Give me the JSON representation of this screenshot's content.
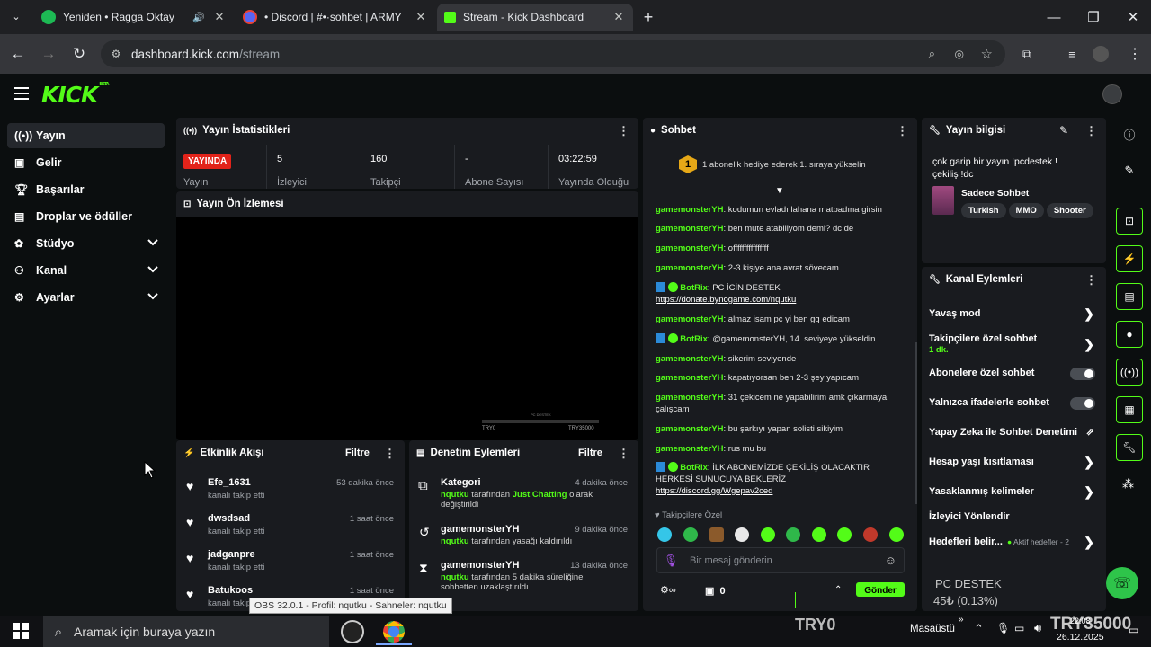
{
  "browser": {
    "tabs": [
      {
        "title": "Yeniden • Ragga Oktay",
        "icon": "spotify-icon",
        "color": "#1db954"
      },
      {
        "title": "• Discord | #•·sohbet | ARMY",
        "icon": "discord-icon",
        "color": "#5865f2"
      },
      {
        "title": "Stream - Kick Dashboard",
        "icon": "kick-icon",
        "color": "#53fc18"
      }
    ],
    "url_host": "dashboard.kick.com",
    "url_path": "/stream"
  },
  "brand": {
    "logo": "KICK",
    "beta": "BETA",
    "accent": "#53fc18"
  },
  "sidebar": {
    "items": [
      {
        "label": "Yayın",
        "icon": "broadcast-icon"
      },
      {
        "label": "Gelir",
        "icon": "revenue-icon"
      },
      {
        "label": "Başarılar",
        "icon": "trophy-icon"
      },
      {
        "label": "Droplar ve ödüller",
        "icon": "gift-icon"
      },
      {
        "label": "Stüdyo",
        "icon": "studio-icon"
      },
      {
        "label": "Kanal",
        "icon": "channel-icon"
      },
      {
        "label": "Ayarlar",
        "icon": "settings-icon"
      }
    ]
  },
  "stats": {
    "title": "Yayın İstatistikleri",
    "live_badge": "YAYINDA",
    "live_label": "Yayın",
    "viewers": "5",
    "viewers_label": "İzleyici",
    "followers": "160",
    "followers_label": "Takipçi",
    "subs": "-",
    "subs_label": "Abone Sayısı",
    "duration": "03:22:59",
    "duration_label": "Yayında Olduğu"
  },
  "preview": {
    "title": "Yayın Ön İzlemesi",
    "left_label": "TRY0",
    "right_label": "TRY35000",
    "top_label": "PC DESTEK"
  },
  "activity": {
    "title": "Etkinlik Akışı",
    "filter": "Filtre",
    "items": [
      {
        "name": "Efe_1631",
        "action": "kanalı takip etti",
        "time": "53 dakika önce"
      },
      {
        "name": "dwsdsad",
        "action": "kanalı takip etti",
        "time": "1 saat önce"
      },
      {
        "name": "jadganpre",
        "action": "kanalı takip etti",
        "time": "1 saat önce"
      },
      {
        "name": "Batukoos",
        "action": "kanalı takip etti",
        "time": "1 saat önce"
      }
    ]
  },
  "moderation": {
    "title": "Denetim Eylemleri",
    "filter": "Filtre",
    "items": [
      {
        "title": "Kategori",
        "actor": "nqutku",
        "text": " tarafından ",
        "highlight": "Just Chatting",
        "text2": " olarak değiştirildi",
        "time": "4 dakika önce"
      },
      {
        "title": "gamemonsterYH",
        "actor": "nqutku",
        "text": " tarafından yasağı kaldırıldı",
        "highlight": "",
        "text2": "",
        "time": "9 dakika önce"
      },
      {
        "title": "gamemonsterYH",
        "actor": "nqutku",
        "text": " tarafından 5 dakika süreliğine sohbetten uzaklaştırıldı",
        "highlight": "",
        "text2": "",
        "time": "13 dakika önce"
      }
    ]
  },
  "chat": {
    "title": "Sohbet",
    "gift_text": "1 abonelik hediye ederek 1. sıraya yükselin",
    "gift_badge": "1",
    "messages": [
      {
        "user": "gamemonsterYH",
        "text": "kodumun evladı lahana matbadına girsin",
        "link": ""
      },
      {
        "user": "gamemonsterYH",
        "text": "ben mute atabiliyom demi? dc de",
        "link": ""
      },
      {
        "user": "gamemonsterYH",
        "text": "offffffffffffffff",
        "link": ""
      },
      {
        "user": "gamemonsterYH",
        "text": "2-3 kişiye ana avrat sövecam",
        "link": ""
      },
      {
        "user": "BotRix",
        "text": "PC İCİN DESTEK",
        "link": "https://donate.bynogame.com/nqutku"
      },
      {
        "user": "gamemonsterYH",
        "text": "almaz isam pc yi ben gg edicam",
        "link": ""
      },
      {
        "user": "BotRix",
        "text": "@gamemonsterYH, 14. seviyeye yükseldin",
        "link": ""
      },
      {
        "user": "gamemonsterYH",
        "text": "sikerim seviyende",
        "link": ""
      },
      {
        "user": "gamemonsterYH",
        "text": "kapatıyorsan ben 2-3 şey yapıcam",
        "link": ""
      },
      {
        "user": "gamemonsterYH",
        "text": "31 çekicem ne yapabilirim amk çıkarmaya çalışcam",
        "link": ""
      },
      {
        "user": "gamemonsterYH",
        "text": "bu şarkıyı yapan solisti sikiyim",
        "link": ""
      },
      {
        "user": "gamemonsterYH",
        "text": "rus mu bu",
        "link": ""
      },
      {
        "user": "BotRix",
        "text": "İLK ABONEMİZDE ÇEKİLİŞ OLACAKTIR HERKESİ SUNUCUYA BEKLERİZ",
        "link": "https://discord.gg/Wgepav2ced"
      }
    ],
    "emote_label": "Takipçilere Özel",
    "input_placeholder": "Bir mesaj gönderin",
    "count": "0",
    "send_label": "Gönder"
  },
  "stream_info": {
    "title": "Yayın bilgisi",
    "stream_title": "çok garip bir yayın !pcdestek ! çekiliş !dc",
    "category": "Sadece Sohbet",
    "tags": [
      "Turkish",
      "MMO",
      "Shooter"
    ]
  },
  "channel_actions": {
    "title": "Kanal Eylemleri",
    "rows": [
      {
        "label": "Yavaş mod",
        "sub": "",
        "control": "chevron"
      },
      {
        "label": "Takipçilere özel sohbet",
        "sub": "1 dk.",
        "control": "chevron"
      },
      {
        "label": "Abonelere özel sohbet",
        "sub": "",
        "control": "toggle"
      },
      {
        "label": "Yalnızca ifadelerle sohbet",
        "sub": "",
        "control": "toggle"
      },
      {
        "label": "Yapay Zeka ile Sohbet Denetimi",
        "sub": "",
        "control": "external"
      },
      {
        "label": "Hesap yaşı kısıtlaması",
        "sub": "",
        "control": "chevron"
      },
      {
        "label": "Yasaklanmış kelimeler",
        "sub": "",
        "control": "chevron"
      },
      {
        "label": "İzleyici Yönlendir",
        "sub": "",
        "control": "none"
      },
      {
        "label": "Hedefleri belir...",
        "sub": "",
        "control": "chevron"
      }
    ],
    "goals_badge": "Aktif hedefler - 2"
  },
  "overlay": {
    "obs_tooltip": "OBS 32.0.1 - Profil: nqutku - Sahneler: nqutku",
    "pc_destek": "PC DESTEK",
    "pc_destek_amount": "45₺ (0.13%)",
    "try0": "TRY0",
    "try35000": "TRY35000"
  },
  "taskbar": {
    "search_placeholder": "Aramak için buraya yazın",
    "desktop": "Masaüstü",
    "time": "22:08",
    "date": "26.12.2025"
  }
}
